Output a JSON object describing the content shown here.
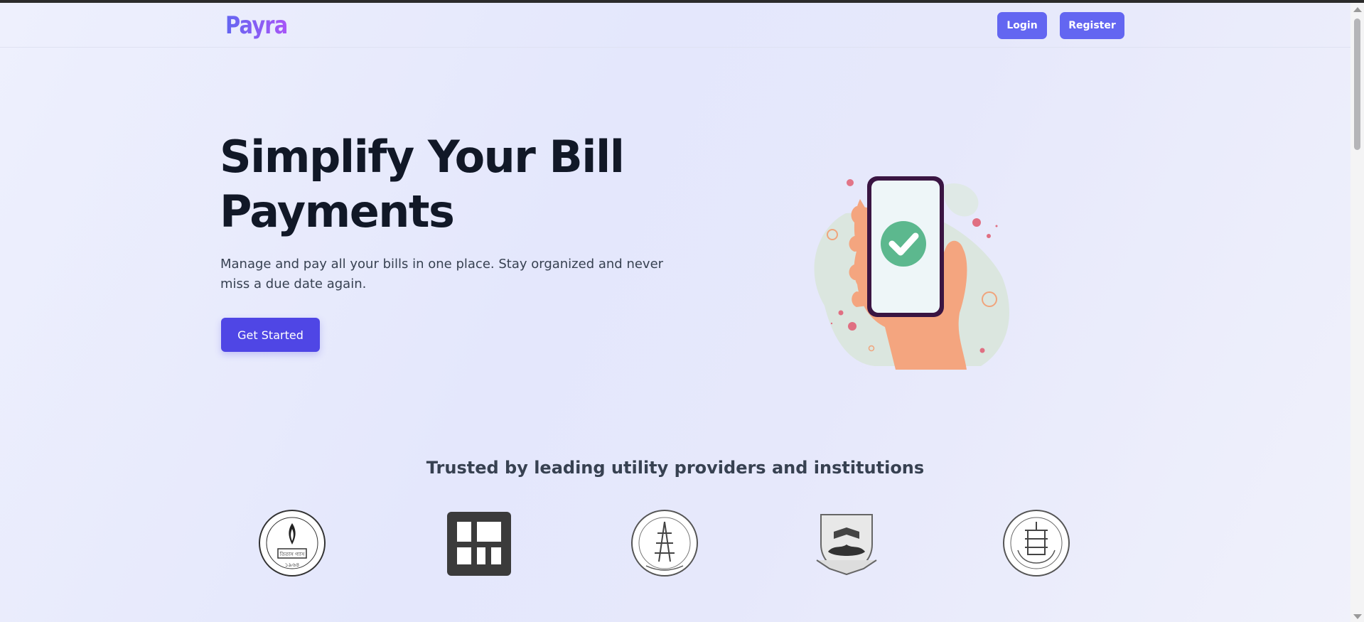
{
  "brand": {
    "name": "Payra",
    "gradient_from": "#6366f1",
    "gradient_to": "#a855f7"
  },
  "nav": {
    "login_label": "Login",
    "register_label": "Register",
    "button_color": "#6366f1"
  },
  "hero": {
    "title": "Simplify Your Bill Payments",
    "subtitle": "Manage and pay all your bills in one place. Stay organized and never miss a due date again.",
    "cta_label": "Get Started",
    "cta_color": "#4f46e5",
    "illustration": "hand-holding-phone-checkmark-icon"
  },
  "trusted": {
    "heading": "Trusted by leading utility providers and institutions",
    "partners": [
      {
        "icon": "titas-gas-seal-icon",
        "seal_text": "তিতাস গ্যাস",
        "year": "১৯৬৪"
      },
      {
        "icon": "square-grid-logo-icon"
      },
      {
        "icon": "power-development-board-seal-icon"
      },
      {
        "icon": "education-board-crest-icon"
      },
      {
        "icon": "bangladesh-bank-seal-icon"
      }
    ]
  }
}
